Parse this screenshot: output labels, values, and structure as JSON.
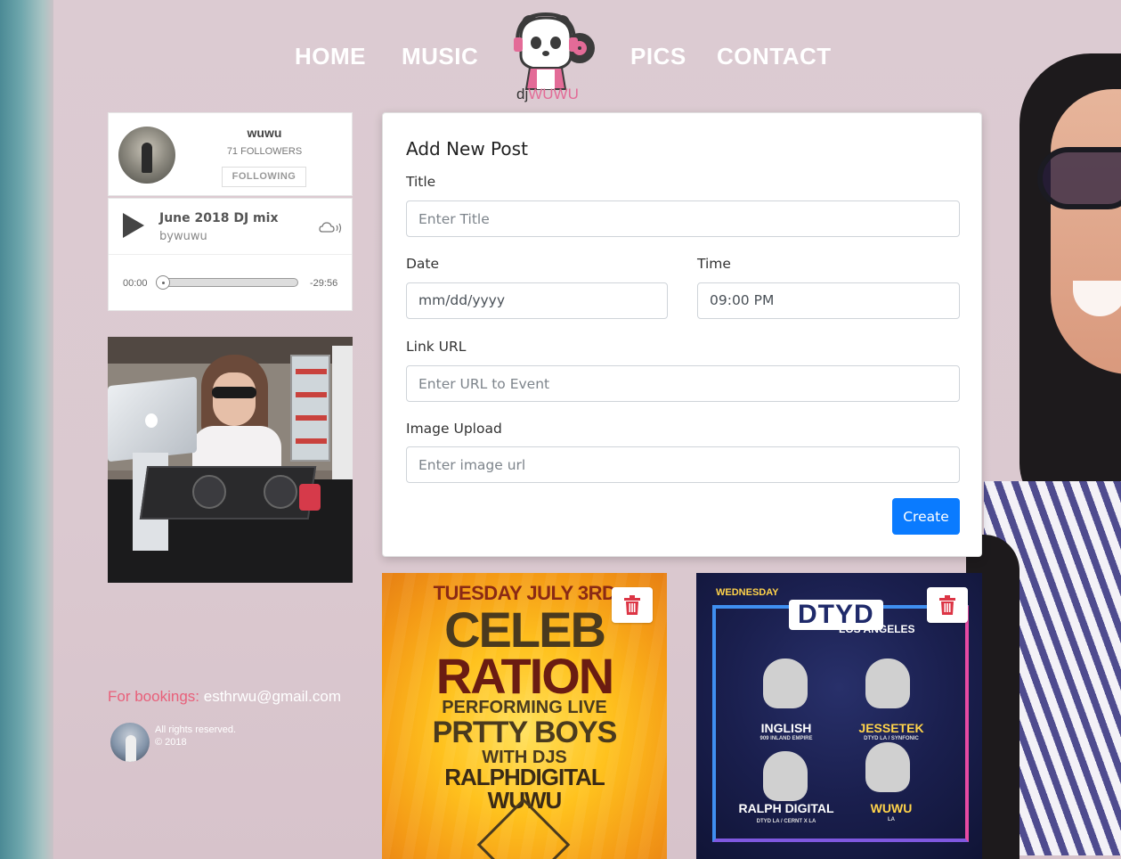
{
  "nav": {
    "home": "HOME",
    "music": "MUSIC",
    "pics": "PICS",
    "contact": "CONTACT",
    "logo_prefix": "dj",
    "logo_accent": "WUWU"
  },
  "profile": {
    "name": "wuwu",
    "followers": "71 FOLLOWERS",
    "follow_label": "FOLLOWING"
  },
  "player": {
    "track_title": "June 2018 DJ mix",
    "track_by": "bywuwu",
    "time_current": "00:00",
    "time_remaining": "-29:56",
    "progress": 0
  },
  "bookings": {
    "label": "For bookings:",
    "email": "esthrwu@gmail.com"
  },
  "footer": {
    "rights": "All rights reserved.",
    "year": "© 2018"
  },
  "form": {
    "title": "Add New Post",
    "title_label": "Title",
    "title_placeholder": "Enter Title",
    "date_label": "Date",
    "date_value": "mm/dd/yyyy",
    "time_label": "Time",
    "time_value": "09:00 PM",
    "link_label": "Link URL",
    "link_placeholder": "Enter URL to Event",
    "image_label": "Image Upload",
    "image_placeholder": "Enter image url",
    "create_label": "Create"
  },
  "posters": {
    "poster1": {
      "line1": "TUESDAY JULY 3RD",
      "line2": "CELEB",
      "line3": "RATION",
      "line4": "PERFORMING LIVE",
      "line5": "PRTTY BOYS",
      "line6": "WITH DJS",
      "line7": "RALPHDIGITAL",
      "line8": "WUWU"
    },
    "poster2": {
      "day": "WEDNESDAY",
      "brand": "DTYD",
      "city": "LOS ANGELES",
      "artist1": "INGLISH",
      "artist1_sub": "909 INLAND EMPIRE",
      "artist2": "JESSETEK",
      "artist2_sub": "DTYD LA / SYNFONIC",
      "artist3": "RALPH DIGITAL",
      "artist3_sub": "DTYD LA / CERNT X LA",
      "artist4": "WUWU",
      "artist4_sub": "LA"
    }
  },
  "colors": {
    "accent_pink": "#e36b97",
    "booking_pink": "#e8607a",
    "primary_button": "#0a7bff",
    "delete_red": "#dc3545"
  },
  "icons": {
    "play": "play-icon",
    "cloud": "soundcloud-icon",
    "delete": "trash-icon"
  }
}
